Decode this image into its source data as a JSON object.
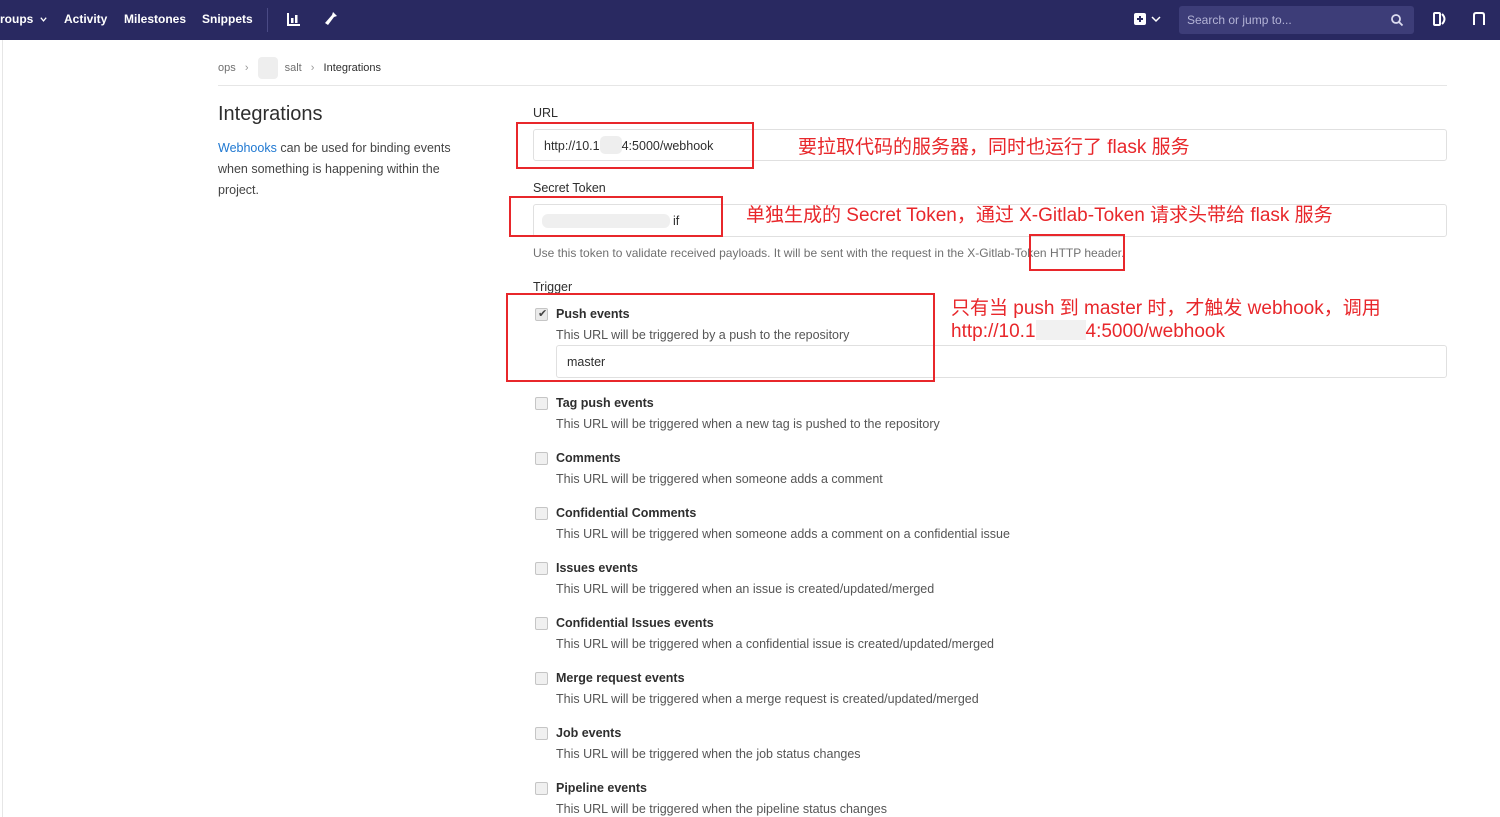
{
  "nav": {
    "groups_label": "roups",
    "activity_label": "Activity",
    "milestones_label": "Milestones",
    "snippets_label": "Snippets",
    "search_placeholder": "Search or jump to..."
  },
  "breadcrumb": {
    "group": "ops",
    "project": "salt",
    "current": "Integrations"
  },
  "section": {
    "title": "Integrations",
    "desc_link": "Webhooks",
    "desc_text": " can be used for binding events when something is happening within the project."
  },
  "form": {
    "url_label": "URL",
    "url_value_prefix": "http://10.1",
    "url_value_suffix": "4:5000/webhook",
    "token_label": "Secret Token",
    "token_value_suffix": "if",
    "token_help": "Use this token to validate received payloads. It will be sent with the request in the X-Gitlab-Token HTTP header.",
    "trigger_label": "Trigger",
    "branch_value": "master"
  },
  "events": [
    {
      "title": "Push events",
      "desc": "This URL will be triggered by a push to the repository",
      "checked": true
    },
    {
      "title": "Tag push events",
      "desc": "This URL will be triggered when a new tag is pushed to the repository",
      "checked": false
    },
    {
      "title": "Comments",
      "desc": "This URL will be triggered when someone adds a comment",
      "checked": false
    },
    {
      "title": "Confidential Comments",
      "desc": "This URL will be triggered when someone adds a comment on a confidential issue",
      "checked": false
    },
    {
      "title": "Issues events",
      "desc": "This URL will be triggered when an issue is created/updated/merged",
      "checked": false
    },
    {
      "title": "Confidential Issues events",
      "desc": "This URL will be triggered when a confidential issue is created/updated/merged",
      "checked": false
    },
    {
      "title": "Merge request events",
      "desc": "This URL will be triggered when a merge request is created/updated/merged",
      "checked": false
    },
    {
      "title": "Job events",
      "desc": "This URL will be triggered when the job status changes",
      "checked": false
    },
    {
      "title": "Pipeline events",
      "desc": "This URL will be triggered when the pipeline status changes",
      "checked": false
    }
  ],
  "annotations": {
    "url_note": "要拉取代码的服务器，同时也运行了 flask 服务",
    "token_note": "单独生成的 Secret Token，通过 X-Gitlab-Token 请求头带给 flask 服务",
    "push_note_line1": "只有当 push 到 master 时，才触发 webhook，调用",
    "push_note_line2_prefix": "http://10.1",
    "push_note_line2_suffix": "4:5000/webhook"
  },
  "colors": {
    "nav_bg": "#292961",
    "annotation_red": "#e8272b",
    "link_blue": "#1f78d1"
  },
  "icons": [
    "chevron-down-icon",
    "chart-icon",
    "wrench-icon",
    "plus-square-icon",
    "search-icon",
    "todo-icon",
    "merge-request-icon",
    "check-icon"
  ]
}
